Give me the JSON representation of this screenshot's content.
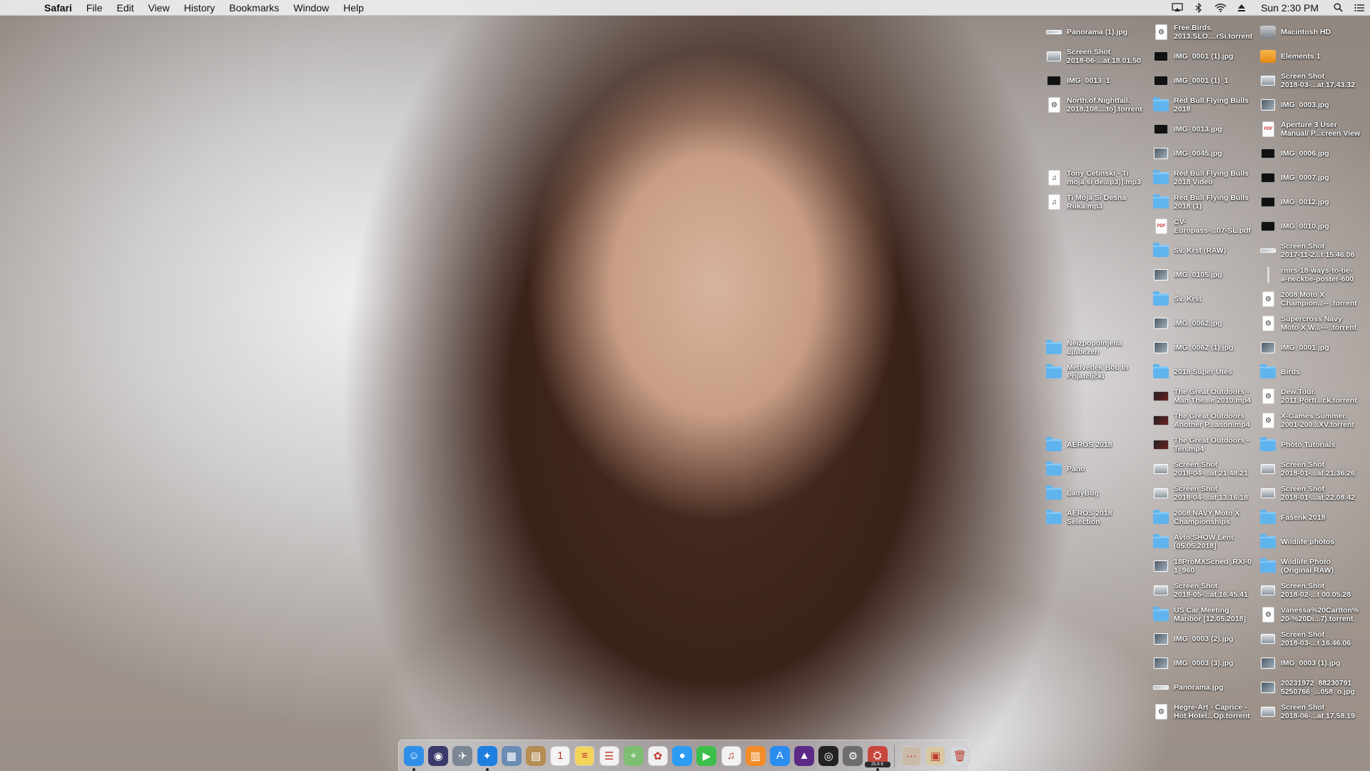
{
  "menubar": {
    "apple": "",
    "app_name": "Safari",
    "items": [
      "File",
      "Edit",
      "View",
      "History",
      "Bookmarks",
      "Window",
      "Help"
    ],
    "clock": "Sun 2:30 PM"
  },
  "desktop_icons": [
    {
      "label": "Panorama (1).jpg",
      "kind": "pano",
      "col": 0,
      "row": 0
    },
    {
      "label": "Screen Shot\n2018-06-...at 18.01.50",
      "kind": "screenshot",
      "col": 0,
      "row": 1
    },
    {
      "label": "IMG_0013_1",
      "kind": "dark",
      "col": 0,
      "row": 2
    },
    {
      "label": "North.of.Nightfall.\n2018.108....to].torrent",
      "kind": "torrent",
      "col": 0,
      "row": 3
    },
    {
      "label": "Tony Cetinski - Ti\nmoja si de...p3)].mp3",
      "kind": "audio",
      "col": 0,
      "row": 6
    },
    {
      "label": "Ti Moja Si Desna\nRuka.mp3",
      "kind": "audio",
      "col": 0,
      "row": 7
    },
    {
      "label": "Neizpopolnjena\nLjubezen",
      "kind": "folder",
      "col": 0,
      "row": 13
    },
    {
      "label": "Medvedek Bou In\nPrijateljčki",
      "kind": "folder",
      "col": 0,
      "row": 14
    },
    {
      "label": "AEROS 2018",
      "kind": "folder",
      "col": 0,
      "row": 17
    },
    {
      "label": "Pano",
      "kind": "folder",
      "col": 0,
      "row": 18
    },
    {
      "label": "LadyBug",
      "kind": "folder",
      "col": 0,
      "row": 19
    },
    {
      "label": "AEROS 2018\nSelection",
      "kind": "folder",
      "col": 0,
      "row": 20
    },
    {
      "label": "Free.Birds.\n2013.SLO....rSi.torrent",
      "kind": "torrent",
      "col": 1,
      "row": 0
    },
    {
      "label": "IMG_0001 (1).jpg",
      "kind": "dark",
      "col": 1,
      "row": 1
    },
    {
      "label": "IMG_0001 (1)_1",
      "kind": "dark",
      "col": 1,
      "row": 2
    },
    {
      "label": "Red Bull Flying Bulls\n2018",
      "kind": "folder",
      "col": 1,
      "row": 3
    },
    {
      "label": "IMG_0013.jpg",
      "kind": "dark",
      "col": 1,
      "row": 4
    },
    {
      "label": "IMG_0045.jpg",
      "kind": "image",
      "col": 1,
      "row": 5
    },
    {
      "label": "Red Bull Flying Bulls\n2018 Video",
      "kind": "folder",
      "col": 1,
      "row": 6
    },
    {
      "label": "Red Bull Flying Bulls\n2018 (1)",
      "kind": "folder",
      "col": 1,
      "row": 7
    },
    {
      "label": "CV-\nEuropass-...07-SL.pdf",
      "kind": "pdf",
      "col": 1,
      "row": 8
    },
    {
      "label": "Sv. Krst (RAW)",
      "kind": "folder",
      "col": 1,
      "row": 9
    },
    {
      "label": "IMG_0105.jpg",
      "kind": "image",
      "col": 1,
      "row": 10
    },
    {
      "label": "Sv. Krst",
      "kind": "folder",
      "col": 1,
      "row": 11
    },
    {
      "label": "IMG_0062.jpg",
      "kind": "image",
      "col": 1,
      "row": 12
    },
    {
      "label": "IMG_0062 (1).jpg",
      "kind": "image",
      "col": 1,
      "row": 13
    },
    {
      "label": "2018 Super Utes",
      "kind": "folder",
      "col": 1,
      "row": 14
    },
    {
      "label": "The Great Outdoors -\nMan The...e 2010.mp4",
      "kind": "video",
      "col": 1,
      "row": 15
    },
    {
      "label": "The Great Outdoors\nAnother P...ason.mp4",
      "kind": "video",
      "col": 1,
      "row": 16
    },
    {
      "label": "The Great Outdoors -\nTen.mp4",
      "kind": "video",
      "col": 1,
      "row": 17
    },
    {
      "label": "Screen Shot\n2018-04-...at 21.48.21",
      "kind": "screenshot",
      "col": 1,
      "row": 18
    },
    {
      "label": "Screen Shot\n2018-04-...at 13.16.18",
      "kind": "screenshot",
      "col": 1,
      "row": 19
    },
    {
      "label": "2008 NAVY Moto X\nChampionships",
      "kind": "folder",
      "col": 1,
      "row": 20
    },
    {
      "label": "Avto SHOW Lent\n[05.05.2018]",
      "kind": "folder",
      "col": 1,
      "row": 21
    },
    {
      "label": "18ProMXSched_RXI-0\n1_960",
      "kind": "image",
      "col": 1,
      "row": 22
    },
    {
      "label": "Screen Shot\n2018-05-...at 16.45.41",
      "kind": "screenshot",
      "col": 1,
      "row": 23
    },
    {
      "label": "US Car Meeting\nMaribor [12.05.2018]",
      "kind": "folder",
      "col": 1,
      "row": 24
    },
    {
      "label": "IMG_0003 (2).jpg",
      "kind": "image",
      "col": 1,
      "row": 25
    },
    {
      "label": "IMG_0003 (3).jpg",
      "kind": "image",
      "col": 1,
      "row": 26
    },
    {
      "label": "Panorama.jpg",
      "kind": "pano",
      "col": 1,
      "row": 27
    },
    {
      "label": "Hegre-Art - Caprice -\nHot Hotel...Op.torrent",
      "kind": "torrent",
      "col": 1,
      "row": 28
    },
    {
      "label": "Macintosh HD",
      "kind": "disk",
      "col": 2,
      "row": 0
    },
    {
      "label": "Elements 1",
      "kind": "disk-orange",
      "col": 2,
      "row": 1
    },
    {
      "label": "Screen Shot\n2018-03-...at 17.43.32",
      "kind": "screenshot",
      "col": 2,
      "row": 2
    },
    {
      "label": "IMG_0003.jpg",
      "kind": "image",
      "col": 2,
      "row": 3
    },
    {
      "label": "Aperture 3 User\nManual/ P...creen View",
      "kind": "pdf",
      "col": 2,
      "row": 4
    },
    {
      "label": "IMG_0006.jpg",
      "kind": "dark",
      "col": 2,
      "row": 5
    },
    {
      "label": "IMG_0007.jpg",
      "kind": "dark",
      "col": 2,
      "row": 6
    },
    {
      "label": "IMG_0012.jpg",
      "kind": "dark",
      "col": 2,
      "row": 7
    },
    {
      "label": "IMG_0010.jpg",
      "kind": "dark",
      "col": 2,
      "row": 8
    },
    {
      "label": "Screen Shot\n2017-11-2...t 15.46.06",
      "kind": "pano",
      "col": 2,
      "row": 9
    },
    {
      "label": "rmrs-18-ways-to-tie-\na-necktie-poster-600",
      "kind": "line",
      "col": 2,
      "row": 10
    },
    {
      "label": "2008 Moto X\nChampion...-- .torrent",
      "kind": "torrent",
      "col": 2,
      "row": 11
    },
    {
      "label": "Supercross Navy\nMoto X W...--- .torrent",
      "kind": "torrent",
      "col": 2,
      "row": 12
    },
    {
      "label": "IMG_0001.jpg",
      "kind": "image",
      "col": 2,
      "row": 13
    },
    {
      "label": "Birds",
      "kind": "folder",
      "col": 2,
      "row": 14
    },
    {
      "label": "Dew.Tour.\n2011.Portl...ck.torrent",
      "kind": "torrent",
      "col": 2,
      "row": 15
    },
    {
      "label": "X-Games.Summer.\n2001-200...XV.torrent",
      "kind": "torrent",
      "col": 2,
      "row": 16
    },
    {
      "label": "Photo Tutorials",
      "kind": "folder",
      "col": 2,
      "row": 17
    },
    {
      "label": "Screen Shot\n2018-01-...at 21.36.26",
      "kind": "screenshot",
      "col": 2,
      "row": 18
    },
    {
      "label": "Screen Shot\n2018-01-...at 22.08.42",
      "kind": "screenshot",
      "col": 2,
      "row": 19
    },
    {
      "label": "Fašenk 2018",
      "kind": "folder",
      "col": 2,
      "row": 20
    },
    {
      "label": "Wildlife photos",
      "kind": "folder",
      "col": 2,
      "row": 21
    },
    {
      "label": "Wildlife Photo\n(Original RAW)",
      "kind": "folder",
      "col": 2,
      "row": 22
    },
    {
      "label": "Screen Shot\n2018-02-...t 00.05.28",
      "kind": "screenshot",
      "col": 2,
      "row": 23
    },
    {
      "label": "Vanessa%20Carlton%\n20-%20Di...7).torrent",
      "kind": "torrent",
      "col": 2,
      "row": 24
    },
    {
      "label": "Screen Shot\n2018-03-...t 16.46.06",
      "kind": "screenshot",
      "col": 2,
      "row": 25
    },
    {
      "label": "IMG_0003 (1).jpg",
      "kind": "image",
      "col": 2,
      "row": 26
    },
    {
      "label": "20231972_88230791\n5250766_...058_o.jpg",
      "kind": "image",
      "col": 2,
      "row": 27
    },
    {
      "label": "Screen Shot\n2018-06-...at 17.58.19",
      "kind": "screenshot",
      "col": 2,
      "row": 28
    }
  ],
  "dock": {
    "items": [
      {
        "name": "finder-icon",
        "glyph": "☺",
        "color": "#2f8fe8",
        "running": true
      },
      {
        "name": "siri-icon",
        "glyph": "◉",
        "color": "#3b3b6b",
        "running": false
      },
      {
        "name": "launchpad-icon",
        "glyph": "✈",
        "color": "#7d8794",
        "running": false
      },
      {
        "name": "safari-icon",
        "glyph": "✦",
        "color": "#1f7fe0",
        "running": true
      },
      {
        "name": "preview-icon",
        "glyph": "▦",
        "color": "#6a8cb3",
        "running": false
      },
      {
        "name": "contacts-icon",
        "glyph": "▤",
        "color": "#b58d55",
        "running": false
      },
      {
        "name": "calendar-icon",
        "glyph": "1",
        "color": "#f4f4f4",
        "running": false
      },
      {
        "name": "notes-icon",
        "glyph": "≡",
        "color": "#f5d45a",
        "running": false
      },
      {
        "name": "reminders-icon",
        "glyph": "☰",
        "color": "#f2f2f2",
        "running": false
      },
      {
        "name": "maps-icon",
        "glyph": "⌖",
        "color": "#7cbf72",
        "running": false
      },
      {
        "name": "photos-icon",
        "glyph": "✿",
        "color": "#f0f0f0",
        "running": false
      },
      {
        "name": "messages-icon",
        "glyph": "●",
        "color": "#2d9cf3",
        "running": false
      },
      {
        "name": "facetime-icon",
        "glyph": "▶",
        "color": "#3bbf4a",
        "running": false
      },
      {
        "name": "itunes-icon",
        "glyph": "♫",
        "color": "#f2f2f2",
        "running": false
      },
      {
        "name": "ibooks-icon",
        "glyph": "▥",
        "color": "#f28c2a",
        "running": false
      },
      {
        "name": "app-store-icon",
        "glyph": "A",
        "color": "#2b8cf0",
        "running": false
      },
      {
        "name": "affinity-photo-icon",
        "glyph": "▲",
        "color": "#5b2a86",
        "running": false
      },
      {
        "name": "aperture-icon",
        "glyph": "◎",
        "color": "#222222",
        "running": false
      },
      {
        "name": "system-preferences-icon",
        "glyph": "⚙",
        "color": "#6d6d6d",
        "running": false
      },
      {
        "name": "transmission-icon",
        "glyph": "⛭",
        "color": "#c9463d",
        "running": true
      },
      {
        "name": "downloads-stack-icon",
        "glyph": "⋯",
        "color": "#c9b9a9",
        "running": false
      },
      {
        "name": "documents-stack-icon",
        "glyph": "▣",
        "color": "#d8c7a0",
        "running": false
      },
      {
        "name": "trash-icon",
        "glyph": "🗑",
        "color": "#d4d6d9",
        "running": false
      }
    ],
    "transmission_badge": "25.8 K"
  },
  "colors": {
    "menubar_bg": "#ececec",
    "folder_blue": "#5fb4ee",
    "label_text": "#ffffff"
  }
}
